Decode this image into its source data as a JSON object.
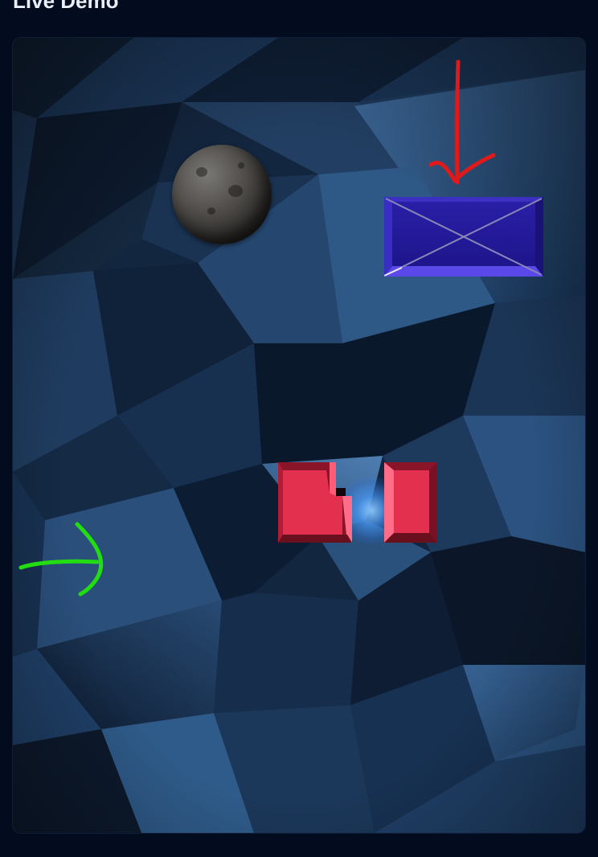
{
  "page": {
    "heading": "Live Demo"
  },
  "game": {
    "entities": [
      {
        "name": "ball",
        "kind": "stone-moon-ball"
      },
      {
        "name": "target",
        "kind": "blue-crossed-block"
      },
      {
        "name": "bumper",
        "kind": "red-split-bumper"
      }
    ],
    "annotations": [
      {
        "name": "red-down-arrow",
        "color": "#e01a1a",
        "points_to": "target"
      },
      {
        "name": "green-right-arrow",
        "color": "#22dd11",
        "points_to": "left-edge"
      }
    ],
    "colors": {
      "page_background": "#020c1e",
      "target_block": "#2a1fa8",
      "bumper": "#e2304e",
      "glow": "#5aa8ff",
      "ball": "#55524f"
    }
  }
}
